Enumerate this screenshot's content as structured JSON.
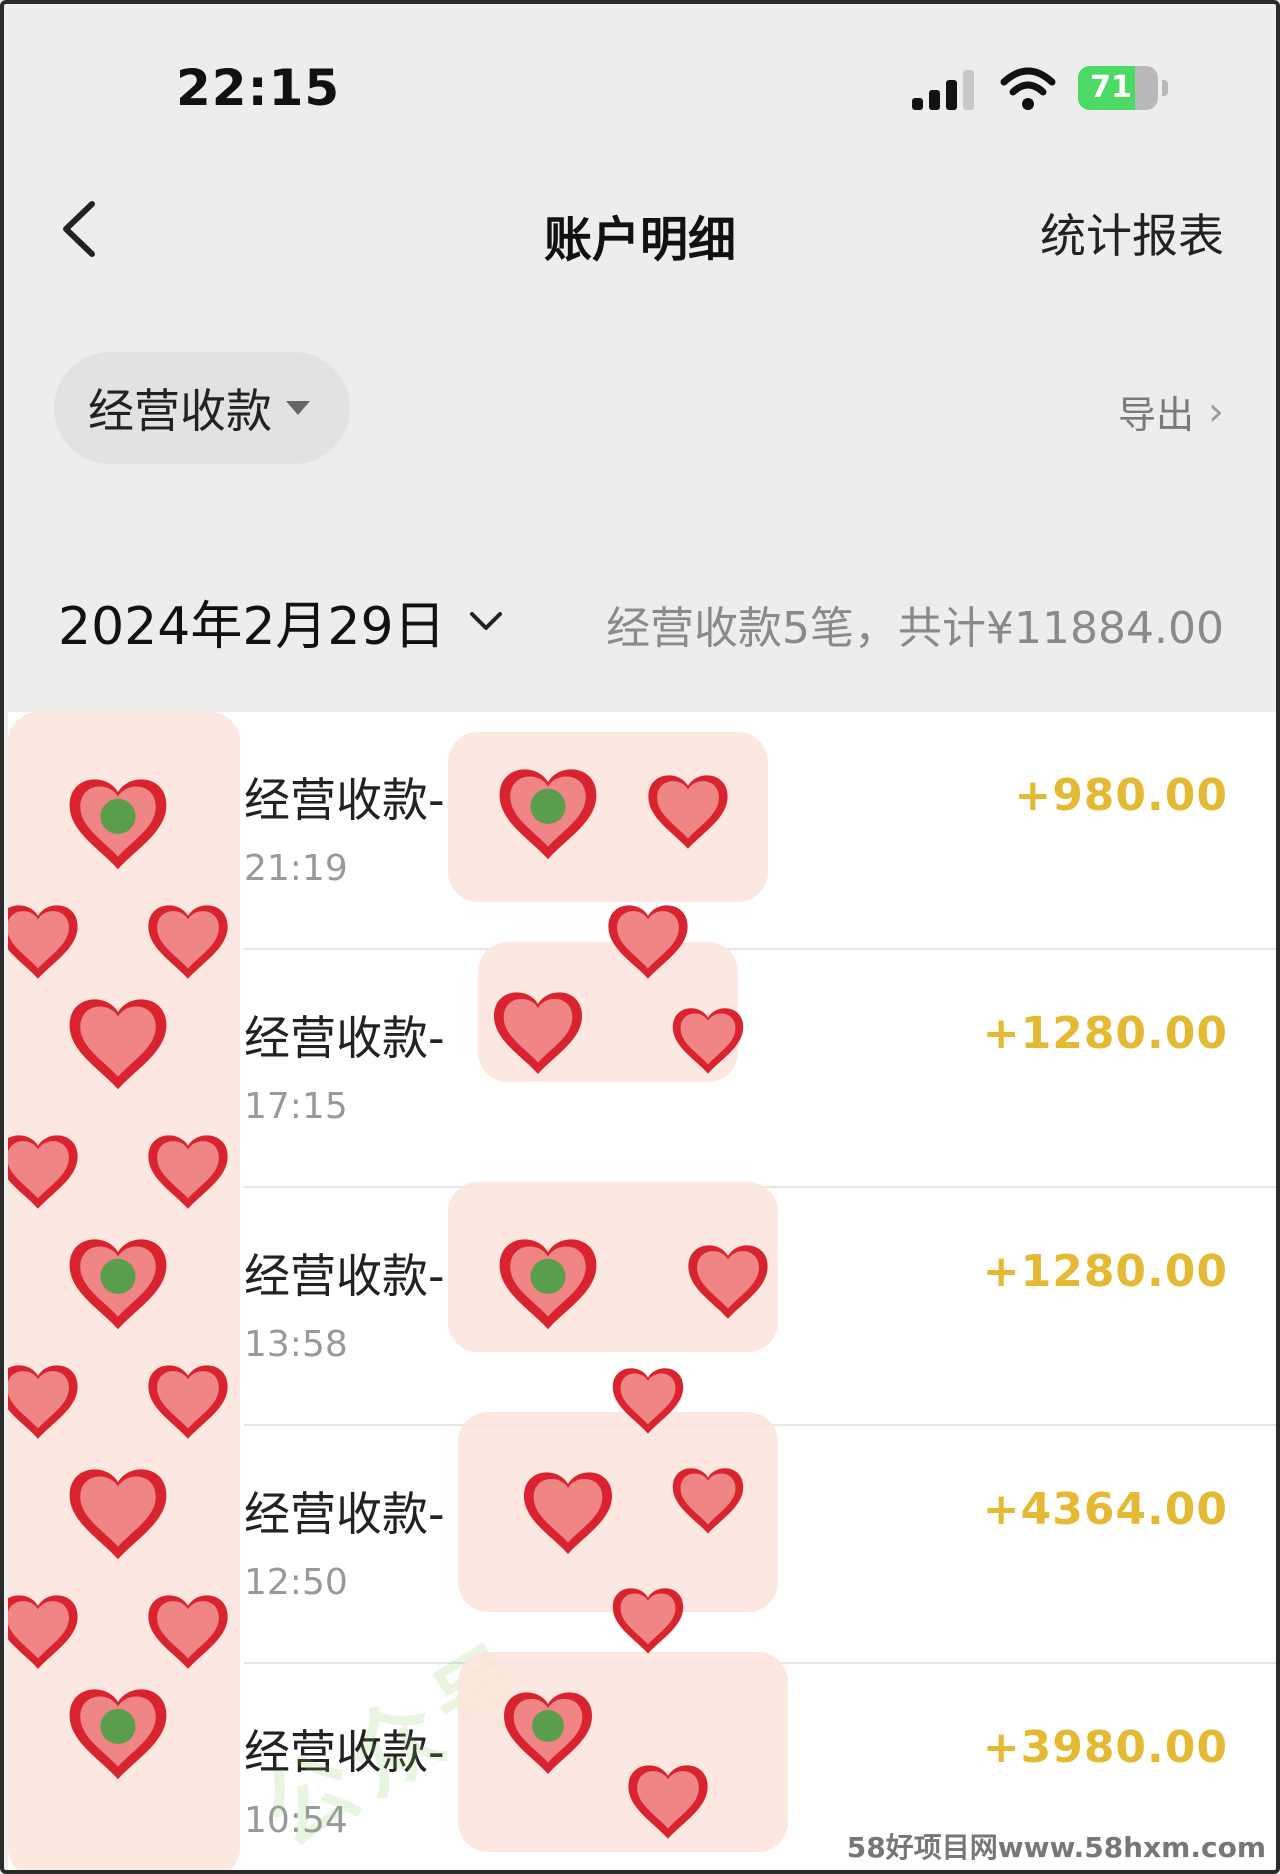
{
  "status_bar": {
    "time": "22:15",
    "battery": "71",
    "battery_level": 0.71,
    "icons": [
      "signal-icon",
      "wifi-icon",
      "battery-icon"
    ]
  },
  "nav": {
    "back_icon": "chevron-left-icon",
    "title": "账户明细",
    "right_action": "统计报表"
  },
  "filter": {
    "selected": "经营收款",
    "export_label": "导出"
  },
  "date_section": {
    "date": "2024年2月29日",
    "summary": "经营收款5笔，共计¥11884.00"
  },
  "transactions": [
    {
      "title": "经营收款-",
      "time": "21:19",
      "amount": "+980.00"
    },
    {
      "title": "经营收款-",
      "time": "17:15",
      "amount": "+1280.00"
    },
    {
      "title": "经营收款-",
      "time": "13:58",
      "amount": "+1280.00"
    },
    {
      "title": "经营收款-",
      "time": "12:50",
      "amount": "+4364.00"
    },
    {
      "title": "经营收款-",
      "time": "10:54",
      "amount": "+3980.00"
    }
  ],
  "colors": {
    "amount": "#e4b934",
    "background": "#ededed",
    "sticker_red": "#d9232e",
    "sticker_pink": "#f08585",
    "sticker_green": "#5a9e4c"
  },
  "watermark": "公众号",
  "footer_watermark": "58好项目网www.58hxm.com"
}
